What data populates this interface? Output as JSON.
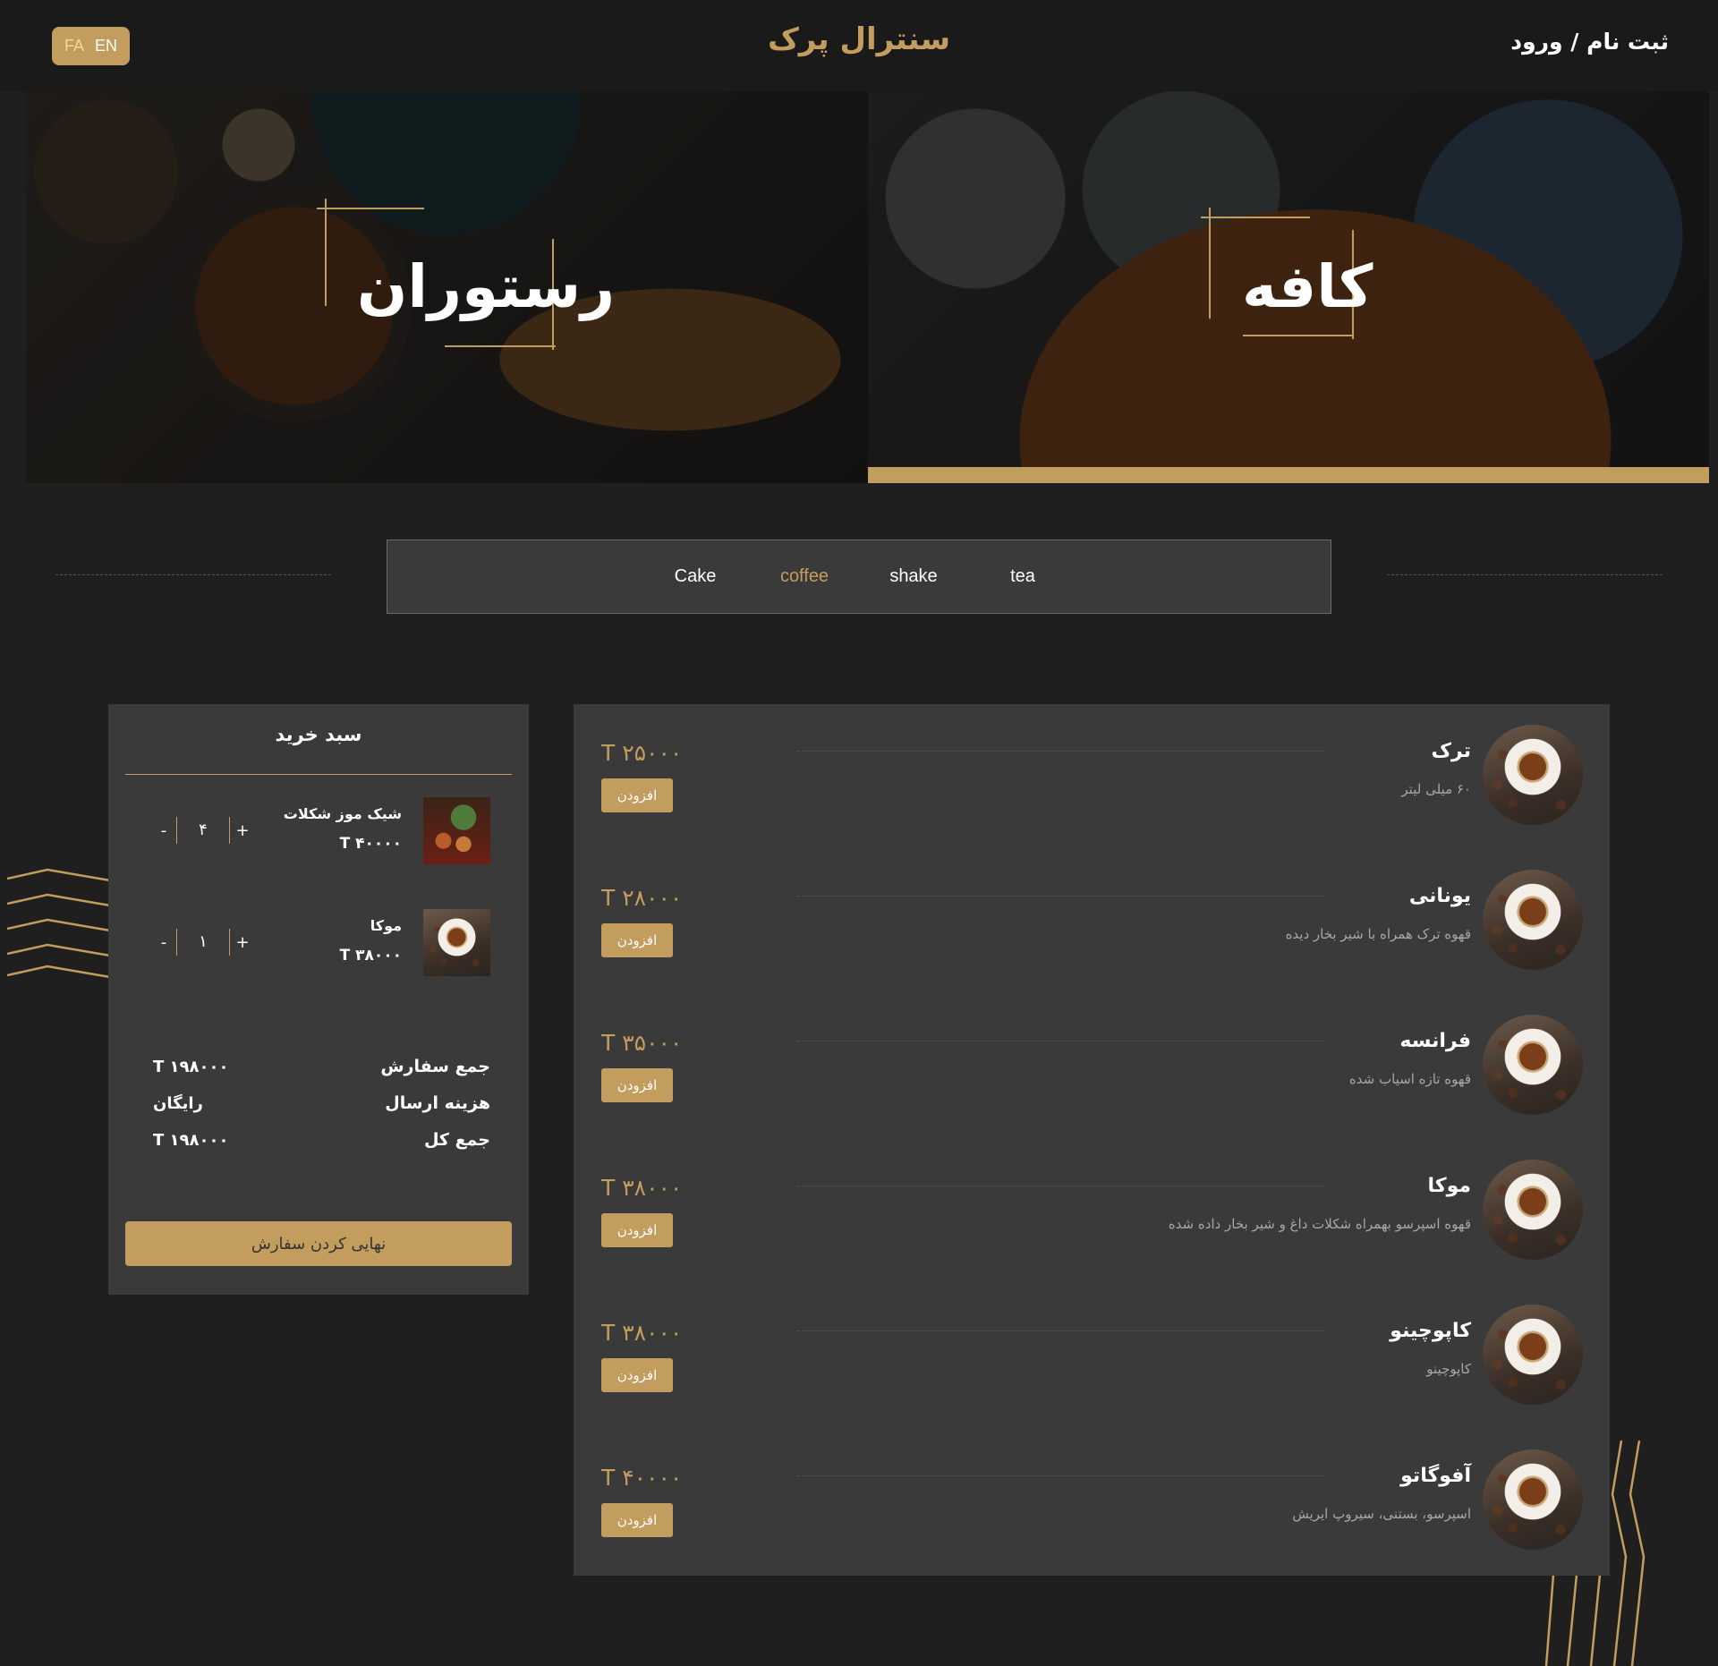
{
  "header": {
    "lang_fa": "FA",
    "lang_en": "EN",
    "brand": "سنترال پرک",
    "auth": "ثبت نام / ورود"
  },
  "hero": {
    "restaurant_label": "رستوران",
    "cafe_label": "کافه"
  },
  "tabs": [
    {
      "label": "Cake",
      "active": false
    },
    {
      "label": "coffee",
      "active": true
    },
    {
      "label": "shake",
      "active": false
    },
    {
      "label": "tea",
      "active": false
    }
  ],
  "cart": {
    "title": "سبد خرید",
    "items": [
      {
        "name": "شیک موز شکلات",
        "price": "T ۴۰۰۰۰",
        "qty": "۴",
        "plus": "+",
        "minus": "-",
        "image": "shake-icon"
      },
      {
        "name": "موکا",
        "price": "T ۳۸۰۰۰",
        "qty": "۱",
        "plus": "+",
        "minus": "-",
        "image": "coffee-icon"
      }
    ],
    "totals": [
      {
        "label": "جمع سفارش",
        "value": "T ۱۹۸۰۰۰"
      },
      {
        "label": "هزینه ارسال",
        "value": "رایگان"
      },
      {
        "label": "جمع کل",
        "value": "T ۱۹۸۰۰۰"
      }
    ],
    "checkout_label": "نهایی کردن سفارش"
  },
  "menu": [
    {
      "name": "ترک",
      "desc": "۶۰ میلی لیتر",
      "price": "T ۲۵۰۰۰",
      "add": "افزودن"
    },
    {
      "name": "یونانی",
      "desc": "قهوه ترک همراه با شیر بخار دیده",
      "price": "T ۲۸۰۰۰",
      "add": "افزودن"
    },
    {
      "name": "فرانسه",
      "desc": "قهوه تازه اسیاب شده",
      "price": "T ۳۵۰۰۰",
      "add": "افزودن"
    },
    {
      "name": "موکا",
      "desc": "قهوه اسپرسو بهمراه شکلات داغ و شیر بخار داده شده",
      "price": "T ۳۸۰۰۰",
      "add": "افزودن"
    },
    {
      "name": "کاپوچینو",
      "desc": "کاپوچینو",
      "price": "T ۳۸۰۰۰",
      "add": "افزودن"
    },
    {
      "name": "آفوگاتو",
      "desc": "اسپرسو، بستنی، سیروپ ایریش",
      "price": "T ۴۰۰۰۰",
      "add": "افزودن"
    }
  ],
  "colors": {
    "accent": "#c39d5e",
    "background": "#1f1f1f",
    "panel": "#3a3a3a"
  }
}
